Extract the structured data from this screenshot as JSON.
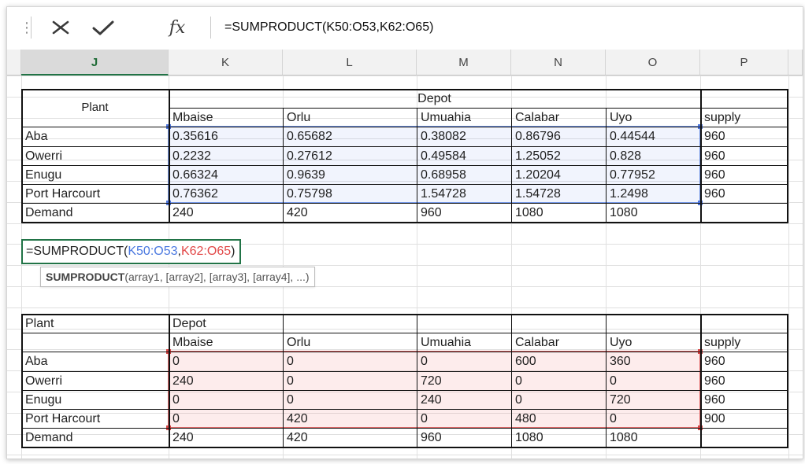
{
  "formula_bar": {
    "cancel_icon": "x-icon",
    "enter_icon": "checkmark-icon",
    "fx_label": "fx",
    "formula": "=SUMPRODUCT(K50:O53,K62:O65)"
  },
  "columns": [
    "J",
    "K",
    "L",
    "M",
    "N",
    "O",
    "P"
  ],
  "active_column": "J",
  "top_table": {
    "plant_header": "Plant",
    "depot_header": "Depot",
    "depots": [
      "Mbaise",
      "Orlu",
      "Umuahia",
      "Calabar",
      "Uyo"
    ],
    "supply_header": "supply",
    "rows": [
      {
        "plant": "Aba",
        "values": [
          "0.35616",
          "0.65682",
          "0.38082",
          "0.86796",
          "0.44544"
        ],
        "supply": "960"
      },
      {
        "plant": "Owerri",
        "values": [
          "0.2232",
          "0.27612",
          "0.49584",
          "1.25052",
          "0.828"
        ],
        "supply": "960"
      },
      {
        "plant": "Enugu",
        "values": [
          "0.66324",
          "0.9639",
          "0.68958",
          "1.20204",
          "0.77952"
        ],
        "supply": "960"
      },
      {
        "plant": "Port Harcourt",
        "values": [
          "0.76362",
          "0.75798",
          "1.54728",
          "1.54728",
          "1.2498"
        ],
        "supply": "960"
      }
    ],
    "demand_label": "Demand",
    "demand": [
      "240",
      "420",
      "960",
      "1080",
      "1080"
    ]
  },
  "editing": {
    "prefix": "=SUMPRODUCT(",
    "ref1": "K50:O53",
    "comma": ",",
    "ref2": "K62:O65",
    "suffix": ")",
    "tooltip_fn": "SUMPRODUCT",
    "tooltip_args": "(array1, [array2], [array3], [array4], ...)"
  },
  "bottom_table": {
    "plant_header": "Plant",
    "depot_header": "Depot",
    "depots": [
      "Mbaise",
      "Orlu",
      "Umuahia",
      "Calabar",
      "Uyo"
    ],
    "supply_header": "supply",
    "rows": [
      {
        "plant": "Aba",
        "values": [
          "0",
          "0",
          "0",
          "600",
          "360"
        ],
        "supply": "960"
      },
      {
        "plant": "Owerri",
        "values": [
          "240",
          "0",
          "720",
          "0",
          "0"
        ],
        "supply": "960"
      },
      {
        "plant": "Enugu",
        "values": [
          "0",
          "0",
          "240",
          "0",
          "720"
        ],
        "supply": "960"
      },
      {
        "plant": "Port Harcourt",
        "values": [
          "0",
          "420",
          "0",
          "480",
          "0"
        ],
        "supply": "900"
      }
    ],
    "demand_label": "Demand",
    "demand": [
      "240",
      "420",
      "960",
      "1080",
      "1080"
    ]
  },
  "colors": {
    "blue_range": "#7396e6",
    "red_range": "#e46b6b",
    "active_green": "#217346"
  }
}
